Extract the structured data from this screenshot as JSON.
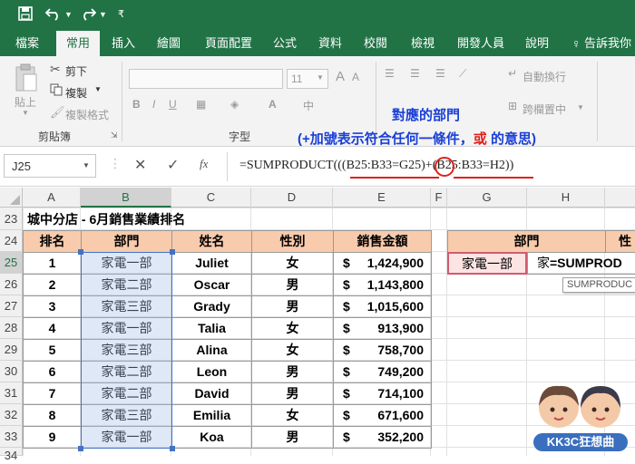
{
  "qat": {
    "save_icon": "save-icon",
    "undo_icon": "undo-icon",
    "redo_icon": "redo-icon",
    "more_icon": "customize-qat-icon"
  },
  "tabs": [
    {
      "label": "檔案"
    },
    {
      "label": "常用"
    },
    {
      "label": "插入"
    },
    {
      "label": "繪圖"
    },
    {
      "label": "頁面配置"
    },
    {
      "label": "公式"
    },
    {
      "label": "資料"
    },
    {
      "label": "校閱"
    },
    {
      "label": "檢視"
    },
    {
      "label": "開發人員"
    },
    {
      "label": "說明"
    },
    {
      "label": "告訴我你"
    }
  ],
  "ribbon": {
    "paste": "貼上",
    "cut": "剪下",
    "copy": "複製",
    "format_painter": "複製格式",
    "clipboard_group": "剪貼簿",
    "font_group": "字型",
    "font_size": "11",
    "wrap_text": "自動換行",
    "merge_center": "跨欄置中"
  },
  "formula_bar": {
    "name_box": "J25",
    "fx": "fx",
    "formula": "=SUMPRODUCT(((B25:B33=G25)+(B25:B33=H2))"
  },
  "annotation": {
    "line1": "對應的部門",
    "line2_a": "(+加號表示符合任何一條件，",
    "line2_or": "或",
    "line2_b": " 的意思)"
  },
  "columns": [
    "A",
    "B",
    "C",
    "D",
    "E",
    "F",
    "G",
    "H"
  ],
  "rows": [
    "23",
    "24",
    "25",
    "26",
    "27",
    "28",
    "29",
    "30",
    "31",
    "32",
    "33",
    "34"
  ],
  "sheet": {
    "title": "城中分店 - 6月銷售業績排名",
    "headers": [
      "排名",
      "部門",
      "姓名",
      "性別",
      "銷售金額"
    ],
    "data": [
      [
        "1",
        "家電一部",
        "Juliet",
        "女",
        "$",
        "1,424,900"
      ],
      [
        "2",
        "家電二部",
        "Oscar",
        "男",
        "$",
        "1,143,800"
      ],
      [
        "3",
        "家電三部",
        "Grady",
        "男",
        "$",
        "1,015,600"
      ],
      [
        "4",
        "家電一部",
        "Talia",
        "女",
        "$",
        "913,900"
      ],
      [
        "5",
        "家電三部",
        "Alina",
        "女",
        "$",
        "758,700"
      ],
      [
        "6",
        "家電二部",
        "Leon",
        "男",
        "$",
        "749,200"
      ],
      [
        "7",
        "家電二部",
        "David",
        "男",
        "$",
        "714,100"
      ],
      [
        "8",
        "家電三部",
        "Emilia",
        "女",
        "$",
        "671,600"
      ],
      [
        "9",
        "家電一部",
        "Koa",
        "男",
        "$",
        "352,200"
      ]
    ],
    "lookup_header_g": "部門",
    "lookup_header_h": "性",
    "lookup_value": "家電一部",
    "edit_cell": "家",
    "edit_formula": "=SUMPROD",
    "tooltip": "SUMPRODUC"
  },
  "watermark": "KK3C狂想曲",
  "colors": {
    "excel_green": "#217346",
    "header_fill": "#f8cbad",
    "annotation_blue": "#1a3fd6",
    "annotation_red": "#e0201b"
  }
}
